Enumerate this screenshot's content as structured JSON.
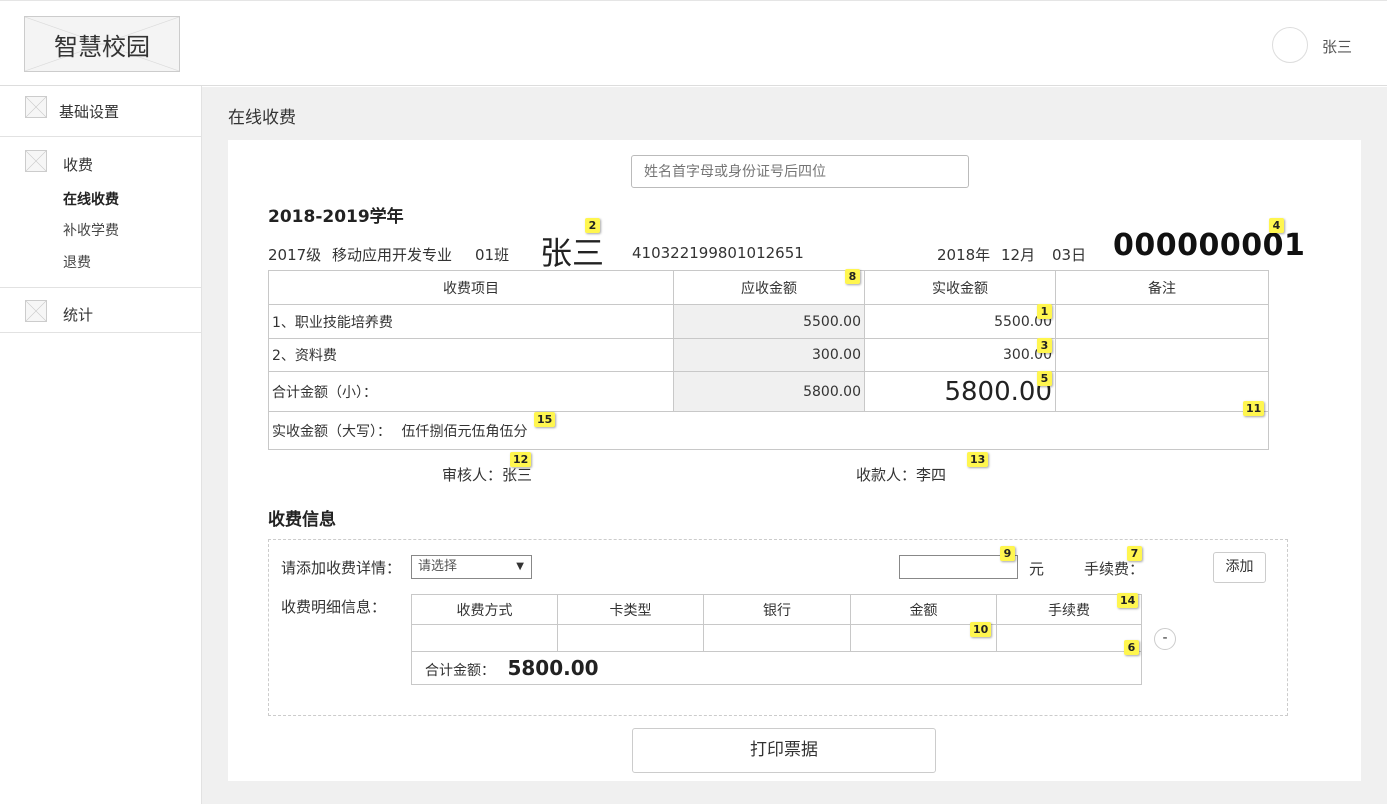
{
  "header": {
    "logo_text": "智慧校园",
    "username": "张三"
  },
  "sidebar": {
    "groups": [
      {
        "label": "基础设置",
        "icon": "placeholder-image-icon"
      },
      {
        "label": "收费",
        "icon": "placeholder-image-icon",
        "items": [
          {
            "label": "在线收费",
            "active": true
          },
          {
            "label": "补收学费"
          },
          {
            "label": "退费"
          }
        ]
      },
      {
        "label": "统计",
        "icon": "placeholder-image-icon"
      }
    ]
  },
  "page": {
    "title": "在线收费"
  },
  "search": {
    "placeholder": "姓名首字母或身份证号后四位"
  },
  "receipt": {
    "school_year": "2018-2019学年",
    "grade": "2017级",
    "major": "移动应用开发专业",
    "class": "01班",
    "student_name": "张三",
    "id_number": "410322199801012651",
    "year": "2018年",
    "month": "12月",
    "day": "03日",
    "serial": "000000001",
    "columns": [
      "收费项目",
      "应收金额",
      "实收金额",
      "备注"
    ],
    "rows": [
      {
        "item": "1、职业技能培养费",
        "due": "5500.00",
        "paid": "5500.00",
        "note": ""
      },
      {
        "item": "2、资料费",
        "due": "300.00",
        "paid": "300.00",
        "note": ""
      }
    ],
    "subtotal": {
      "label": "合计金额（小）：",
      "due": "5800.00",
      "paid": "5800.00"
    },
    "capital": {
      "label": "实收金额（大写）：",
      "value": "伍仟捌佰元伍角伍分"
    },
    "reviewer": "审核人：张三",
    "cashier": "收款人：李四"
  },
  "payment": {
    "section_title": "收费信息",
    "add_detail_label": "请添加收费详情：",
    "select_value": "请选择",
    "currency": "元",
    "fee_label": "手续费：",
    "add_button": "添加",
    "detail_label": "收费明细信息：",
    "columns": [
      "收费方式",
      "卡类型",
      "银行",
      "金额",
      "手续费"
    ],
    "total_label": "合计金额：",
    "total_value": "5800.00",
    "remove_button": "-"
  },
  "print_button": "打印票据",
  "annotations": [
    "1",
    "2",
    "3",
    "4",
    "5",
    "6",
    "7",
    "8",
    "9",
    "10",
    "11",
    "12",
    "13",
    "14",
    "15"
  ],
  "colors": {
    "badge": "#fff64f",
    "main_bg": "#f0f0f0",
    "readonly_cell": "#f0f0f0"
  }
}
